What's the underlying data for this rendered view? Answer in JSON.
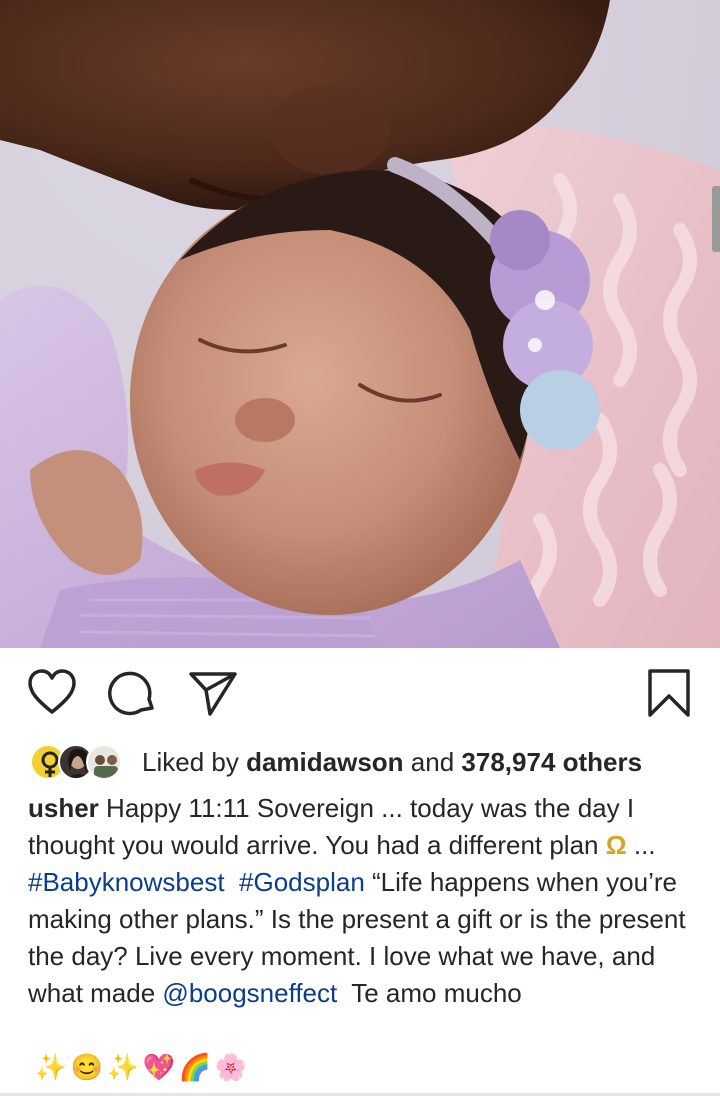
{
  "post": {
    "image_alt": "",
    "likes": {
      "prefix": "Liked by",
      "first_liker": "damidawson",
      "connector": "and",
      "others": "378,974 others"
    },
    "caption": {
      "username": "usher",
      "line1": "Happy 11:11 Sovereign ... today was the day I thought you would arrive. You had a different plan",
      "omega_glyph": "Ω",
      "line2_pre": "...",
      "hashtag1": "#Babyknowsbest",
      "hashtag2": "#Godsplan",
      "line3": "“Life happens when you’re making other plans.” Is the present a gift or is the present the day? Live every moment. I love what we have, and what made",
      "mention": "@boogsneffect",
      "line4": "Te amo mucho"
    },
    "emojis": [
      "✨",
      "😊",
      "✨",
      "💖",
      "🌈",
      "🌸"
    ]
  },
  "icons": {
    "like": "heart-icon",
    "comment": "comment-icon",
    "share": "send-icon",
    "save": "bookmark-icon"
  },
  "colors": {
    "text": "#262626",
    "link": "#0b3d8c",
    "accent_omega": "#d8a421"
  }
}
